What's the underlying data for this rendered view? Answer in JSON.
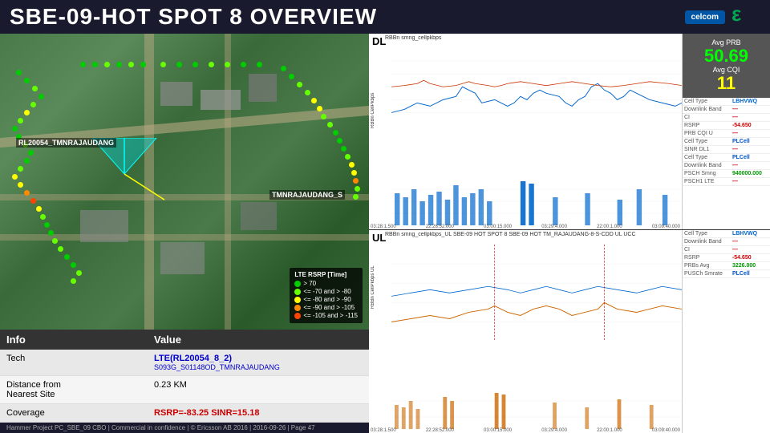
{
  "header": {
    "title": "SBE-09-HOT SPOT 8 OVERVIEW",
    "logos": {
      "celcom": "celcom",
      "ericsson": "≡"
    }
  },
  "map": {
    "site_label1": "RL20054_TMNRAJAUDANG",
    "site_label2": "TMNRAJAUDANG_S",
    "legend_title": "LTE RSRP [Time]",
    "legend_items": [
      {
        "label": "> 70",
        "color": "#00cc00"
      },
      {
        "label": "<= -70 and > -80",
        "color": "#66ff00"
      },
      {
        "label": "<= -80 and > -90",
        "color": "#ffff00"
      },
      {
        "label": "<= -90 and > -105",
        "color": "#ff8800"
      },
      {
        "label": "<= -105 and > -115",
        "color": "#ff4400"
      }
    ]
  },
  "info_table": {
    "header_info": "Info",
    "header_value": "Value",
    "rows": [
      {
        "info": "Tech",
        "value": "LTE(RL20054_8_2)",
        "sub_value": "S093G_S01148OD_TMNRAJAUDANG",
        "type": "tech"
      },
      {
        "info": "Distance from Nearest Site",
        "value": "0.23 KM",
        "type": "distance"
      },
      {
        "info": "Coverage",
        "value": "RSRP=-83.25 SINR=15.18",
        "type": "coverage"
      }
    ]
  },
  "footer": {
    "text": "Hammer Project PC_SBE_09 CBO  |  Commercial in confidence  |  © Ericsson AB 2016  |  2016-09-26  |  Page  47"
  },
  "dl_section": {
    "label": "DL",
    "chart_title": "RBBn smng_cellpkbps"
  },
  "ul_section": {
    "label": "UL"
  },
  "stats": {
    "avg_prb_label": "Avg PRB",
    "avg_prb_value": "50.69",
    "avg_cqi_label": "Avg CQI",
    "avg_cqi_value": "11",
    "table_rows_dl": [
      {
        "label": "Cell Type",
        "value": "LBHVWQ"
      },
      {
        "label": "Downlink Band",
        "value": "—"
      },
      {
        "label": "CI",
        "value": "—"
      },
      {
        "label": "RSRP",
        "value": "-54.650"
      },
      {
        "label": "PRB CQI U",
        "value": "—"
      },
      {
        "label": "Cell Type",
        "value": "PLCell"
      },
      {
        "label": "SINR DL1",
        "value": "—"
      },
      {
        "label": "Cell Type",
        "value": "PLCell"
      },
      {
        "label": "Downlink Band",
        "value": "—"
      },
      {
        "label": "PSCH Smng",
        "value": "940000.000"
      },
      {
        "label": "PSCH1 LTE",
        "value": "—"
      }
    ],
    "table_rows_ul": [
      {
        "label": "Cell Type",
        "value": "LBHVWQ"
      },
      {
        "label": "Downlink Band",
        "value": "—"
      },
      {
        "label": "CI",
        "value": "—"
      },
      {
        "label": "RSRP",
        "value": "-54.650"
      },
      {
        "label": "PRBs Avg",
        "value": "3226.000"
      },
      {
        "label": "PUSCh Smrate",
        "value": "PLCell"
      }
    ]
  },
  "time_labels": [
    "03:28:1.500",
    "22:28.52.000",
    "03:00:15.000",
    "03:29:4.000",
    "22:00:1.000",
    "03:09:40.000"
  ]
}
